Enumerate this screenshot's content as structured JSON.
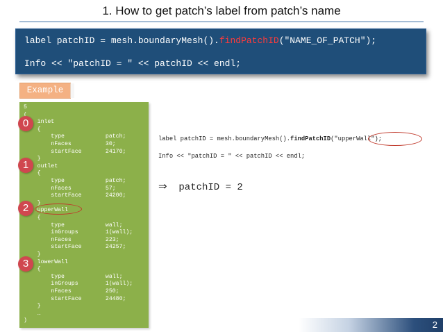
{
  "slide": {
    "title": "1. How to get patch’s label from patch’s name",
    "page_number": "2"
  },
  "code_box": {
    "line1_prefix": "label patchID = mesh.boundaryMesh().",
    "line1_fn": "findPatchID",
    "line1_suffix": "(\"NAME_OF_PATCH\");",
    "line2": "Info << \"patchID = \" << patchID << endl;"
  },
  "example_label": "Example",
  "boundary_file": {
    "lines": [
      "5",
      "(",
      "    inlet",
      "    {",
      "        type            patch;",
      "        nFaces          30;",
      "        startFace       24170;",
      "    }",
      "    outlet",
      "    {",
      "        type            patch;",
      "        nFaces          57;",
      "        startFace       24200;",
      "    }",
      "    upperWall",
      "    {",
      "        type            wall;",
      "        inGroups        1(wall);",
      "        nFaces          223;",
      "        startFace       24257;",
      "    }",
      "    lowerWall",
      "    {",
      "        type            wall;",
      "        inGroups        1(wall);",
      "        nFaces          250;",
      "        startFace       24480;",
      "    }",
      "    …",
      ")"
    ],
    "badges": [
      "0",
      "1",
      "2",
      "3"
    ]
  },
  "example_code": {
    "line1_prefix": "label patchID = mesh.boundaryMesh().",
    "line1_fn": "findPatchID",
    "line1_suffix": "(\"upperWall\");",
    "line2": "Info << \"patchID = \" << patchID << endl;"
  },
  "result": {
    "arrow": "⇒",
    "text": "patchID = 2"
  },
  "colors": {
    "code_box_bg": "#1f4e79",
    "highlight": "#ff3b3b",
    "example_tag": "#f4b183",
    "green_panel": "#8cb04a",
    "badge": "#d0474f"
  }
}
